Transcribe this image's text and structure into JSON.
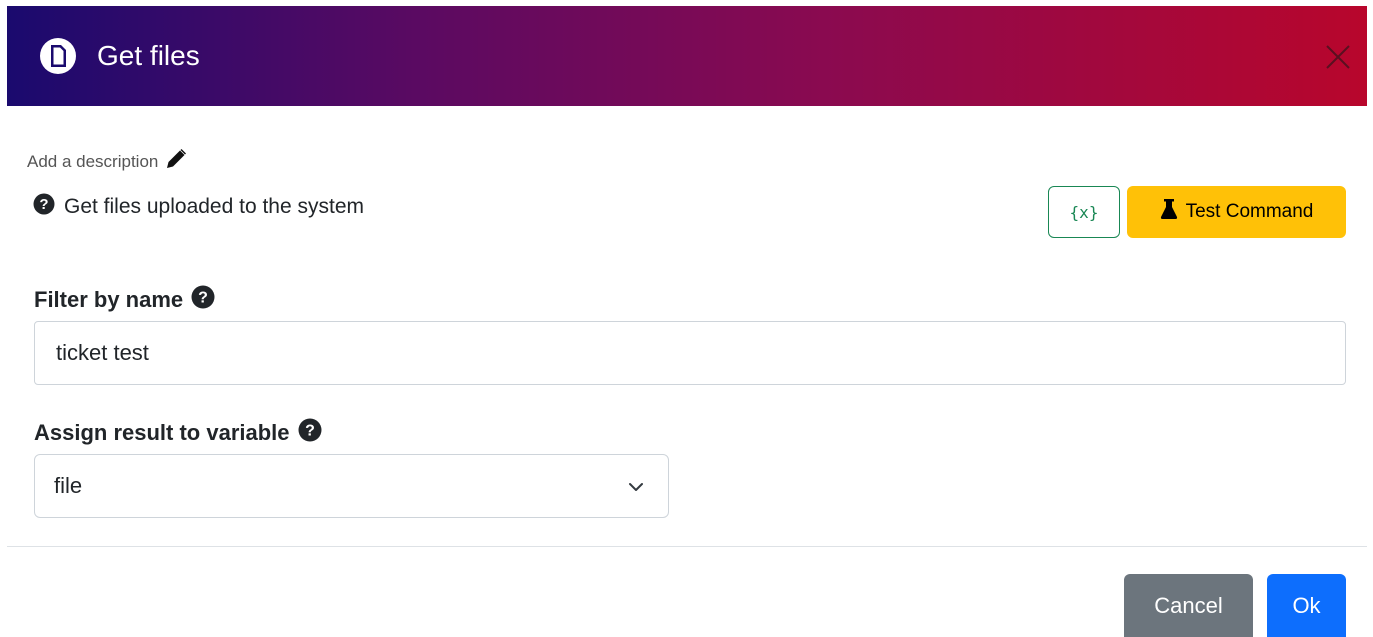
{
  "dialog": {
    "title": "Get files",
    "title_icon": "file-icon",
    "close_icon": "close-icon"
  },
  "description": {
    "add_label": "Add a description",
    "edit_icon": "pencil-icon",
    "help_icon": "question-circle-icon",
    "text": "Get files uploaded to the system"
  },
  "toolbar": {
    "variables_label": "{x}",
    "test_icon": "flask-icon",
    "test_label": "Test Command"
  },
  "form": {
    "filter": {
      "label": "Filter by name",
      "help_icon": "question-circle-icon",
      "value": "ticket test"
    },
    "assign": {
      "label": "Assign result to variable",
      "help_icon": "question-circle-icon",
      "selected": "file",
      "chevron_icon": "chevron-down-icon"
    }
  },
  "footer": {
    "cancel_label": "Cancel",
    "ok_label": "Ok"
  },
  "colors": {
    "header_gradient_start": "#1a0a6e",
    "header_gradient_end": "#b8062c",
    "test_button": "#ffc107",
    "variables_button": "#198754",
    "cancel_button": "#6c757d",
    "ok_button": "#0d6efd"
  }
}
